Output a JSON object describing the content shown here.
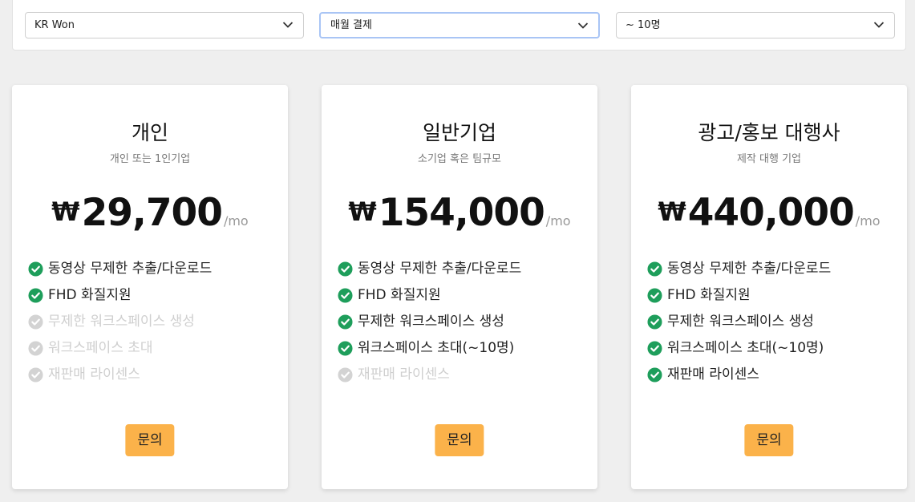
{
  "filters": {
    "currency": "KR Won",
    "billing": "매월 결제",
    "team_size": "~ 10명"
  },
  "colors": {
    "check_on": "#1e9e5b",
    "check_off": "#d3d3d3",
    "button": "#fbb24a"
  },
  "plans": [
    {
      "name": "개인",
      "description": "개인 또는 1인기업",
      "currency_symbol": "₩",
      "price": "29,700",
      "period": "/mo",
      "features": [
        {
          "label": "동영상 무제한 추출/다운로드",
          "enabled": true
        },
        {
          "label": "FHD 화질지원",
          "enabled": true
        },
        {
          "label": "무제한 워크스페이스 생성",
          "enabled": false
        },
        {
          "label": "워크스페이스 초대",
          "enabled": false
        },
        {
          "label": "재판매 라이센스",
          "enabled": false
        }
      ],
      "button": "문의"
    },
    {
      "name": "일반기업",
      "description": "소기업 혹은 팀규모",
      "currency_symbol": "₩",
      "price": "154,000",
      "period": "/mo",
      "features": [
        {
          "label": "동영상 무제한 추출/다운로드",
          "enabled": true
        },
        {
          "label": "FHD 화질지원",
          "enabled": true
        },
        {
          "label": "무제한 워크스페이스 생성",
          "enabled": true
        },
        {
          "label": "워크스페이스 초대(~10명)",
          "enabled": true
        },
        {
          "label": "재판매 라이센스",
          "enabled": false
        }
      ],
      "button": "문의"
    },
    {
      "name": "광고/홍보 대행사",
      "description": "제작 대행 기업",
      "currency_symbol": "₩",
      "price": "440,000",
      "period": "/mo",
      "features": [
        {
          "label": "동영상 무제한 추출/다운로드",
          "enabled": true
        },
        {
          "label": "FHD 화질지원",
          "enabled": true
        },
        {
          "label": "무제한 워크스페이스 생성",
          "enabled": true
        },
        {
          "label": "워크스페이스 초대(~10명)",
          "enabled": true
        },
        {
          "label": "재판매 라이센스",
          "enabled": true
        }
      ],
      "button": "문의"
    }
  ]
}
